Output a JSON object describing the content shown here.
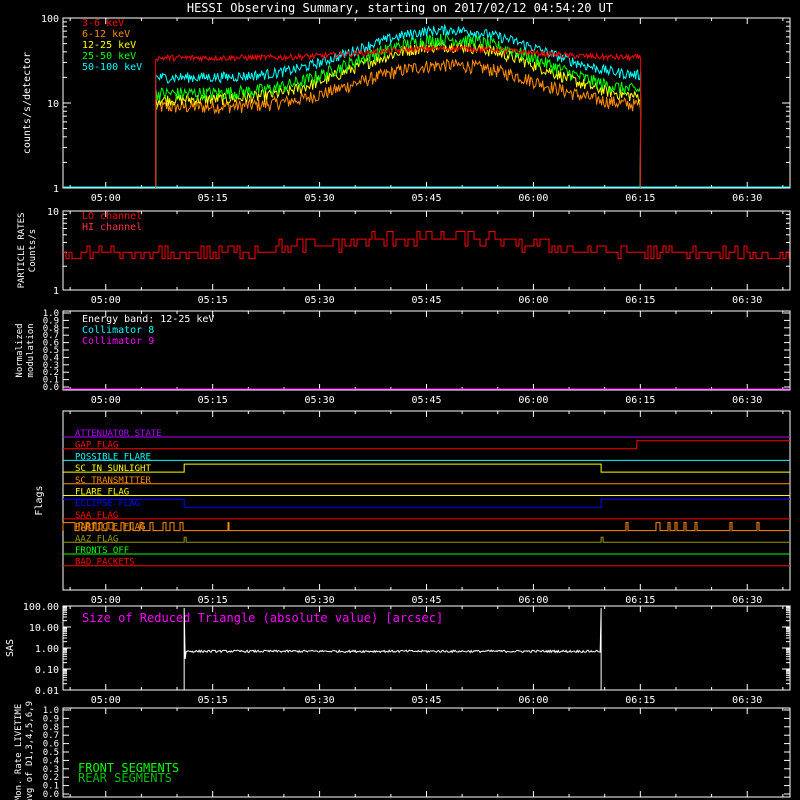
{
  "title": "HESSI Observing Summary, starting on 2017/02/12 04:54:20 UT",
  "time_axis": {
    "ticks": [
      "05:00",
      "05:15",
      "05:30",
      "05:45",
      "06:00",
      "06:15",
      "06:30"
    ],
    "tick_minutes": [
      0,
      15,
      30,
      45,
      60,
      75,
      90
    ],
    "start_minute": -6,
    "end_minute": 96
  },
  "colors": {
    "background": "#000000",
    "axes": "#ffffff",
    "red": "#ff0000",
    "orange": "#ff8c00",
    "yellow": "#ffff00",
    "green": "#00ff00",
    "cyan": "#00ffff",
    "magenta": "#ff00ff",
    "blue": "#0000ff",
    "olive": "#9a9a00",
    "purple": "#b000ff"
  },
  "chart_data": [
    {
      "type": "line",
      "panel": "count_rates",
      "ylabel": "counts/s/detector",
      "ylog": true,
      "ylim": [
        1,
        100
      ],
      "yticks": [
        "1",
        "10",
        "100"
      ],
      "obs_start_minute": 7,
      "obs_end_minute": 75,
      "series": [
        {
          "name": "3-6 keV",
          "color": "#ff0000",
          "base": 34,
          "peak": 44,
          "noise": 0.08
        },
        {
          "name": "6-12 keV",
          "color": "#ff8c00",
          "base": 9,
          "peak": 28,
          "noise": 0.18
        },
        {
          "name": "12-25 keV",
          "color": "#ffff00",
          "base": 11,
          "peak": 47,
          "noise": 0.16
        },
        {
          "name": "25-50 keV",
          "color": "#00ff00",
          "base": 13,
          "peak": 56,
          "noise": 0.18
        },
        {
          "name": "50-100 keV",
          "color": "#00ffff",
          "base": 20,
          "peak": 72,
          "noise": 0.14
        }
      ]
    },
    {
      "type": "line",
      "panel": "particle_rates",
      "ylabel": "PARTICLE RATES",
      "ylabel2": "Counts/s",
      "ylog": true,
      "ylim": [
        1,
        10
      ],
      "yticks": [
        "1",
        "10"
      ],
      "series": [
        {
          "name": "LO channel",
          "color": "#ff0000",
          "level": 3.0
        },
        {
          "name": "HI channel",
          "color": "#ff0000",
          "level": 3.0
        }
      ]
    },
    {
      "type": "line",
      "panel": "modulation",
      "ylabel": "Normalized",
      "ylabel2": "modulation",
      "ylim": [
        0,
        1
      ],
      "yticks": [
        "0.0",
        "0.1",
        "0.2",
        "0.3",
        "0.4",
        "0.5",
        "0.6",
        "0.7",
        "0.8",
        "0.9",
        "1.0"
      ],
      "annotation": "Energy band: 12-25 keV",
      "series": [
        {
          "name": "Collimator 8",
          "color": "#00ffff",
          "value": 0.0
        },
        {
          "name": "Collimator 9",
          "color": "#ff00ff",
          "value": 0.0
        }
      ]
    },
    {
      "type": "line",
      "panel": "flags",
      "ylabel": "Flags",
      "series": [
        {
          "name": "ATTENUATOR STATE",
          "color": "#b000ff",
          "mode": "flat"
        },
        {
          "name": "GAP FLAG",
          "color": "#ff0000",
          "mode": "step",
          "high_from": 74.5
        },
        {
          "name": "POSSIBLE FLARE",
          "color": "#00ffff",
          "mode": "flat"
        },
        {
          "name": "SC IN SUNLIGHT",
          "color": "#ffff00",
          "mode": "window",
          "from": 11,
          "to": 69.5
        },
        {
          "name": "SC TRANSMITTER",
          "color": "#ff8c00",
          "mode": "flat"
        },
        {
          "name": "FLARE FLAG",
          "color": "#ffff00",
          "mode": "flat"
        },
        {
          "name": "ECLIPSE FLAG",
          "color": "#0000ff",
          "mode": "eclipse",
          "from": 11,
          "to": 69.5
        },
        {
          "name": "SAA FLAG",
          "color": "#ff0000",
          "mode": "flat"
        },
        {
          "name": "PARTICLE FLAG",
          "color": "#ff8c00",
          "mode": "particle"
        },
        {
          "name": "AAZ FLAG",
          "color": "#9a9a00",
          "mode": "spikes",
          "at": [
            11,
            69.5
          ]
        },
        {
          "name": "FRONTS OFF",
          "color": "#00ff00",
          "mode": "flat"
        },
        {
          "name": "BAD PACKETS",
          "color": "#ff0000",
          "mode": "flat"
        }
      ]
    },
    {
      "type": "line",
      "panel": "sas",
      "ylabel": "SAS",
      "ylog": true,
      "ylim": [
        0.01,
        100
      ],
      "yticks": [
        "0.01",
        "0.10",
        "1.00",
        "10.00",
        "100.00"
      ],
      "annotation": "Size of Reduced Triangle (absolute value) [arcsec]",
      "series": [
        {
          "name": "triangle size",
          "color": "#ffffff",
          "from": 11,
          "to": 69.5,
          "level": 0.7
        }
      ]
    },
    {
      "type": "line",
      "panel": "livetime",
      "ylabel": "Mon. Rate LIVETIME",
      "ylabel2": "avg of D1,3,4,5,6,9",
      "ylim": [
        0,
        1
      ],
      "yticks": [
        "0.0",
        "0.1",
        "0.2",
        "0.3",
        "0.4",
        "0.5",
        "0.6",
        "0.7",
        "0.8",
        "0.9",
        "1.0"
      ],
      "series": [
        {
          "name": "FRONT SEGMENTS",
          "color": "#00ff00"
        },
        {
          "name": "REAR SEGMENTS",
          "color": "#00c000"
        }
      ]
    }
  ]
}
